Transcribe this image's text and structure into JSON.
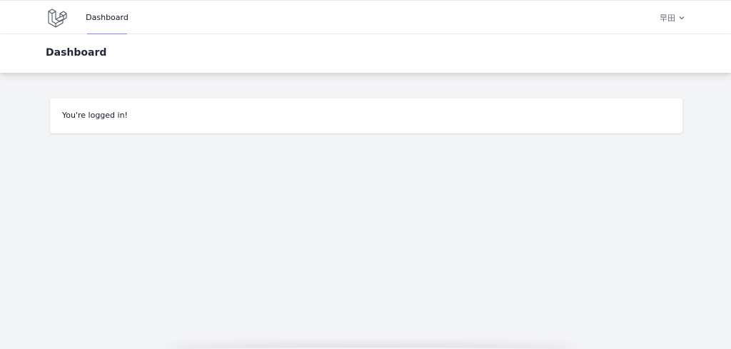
{
  "nav": {
    "logo_icon": "laravel-logo-icon",
    "dashboard_label": "Dashboard",
    "user_name": "早田",
    "user_chevron_icon": "chevron-down-icon"
  },
  "header": {
    "title": "Dashboard"
  },
  "card": {
    "message": "You're logged in!"
  },
  "colors": {
    "accent": "#818cf8",
    "background": "#f3f4f6",
    "surface": "#ffffff",
    "text": "#111827",
    "muted": "#6b7280"
  }
}
